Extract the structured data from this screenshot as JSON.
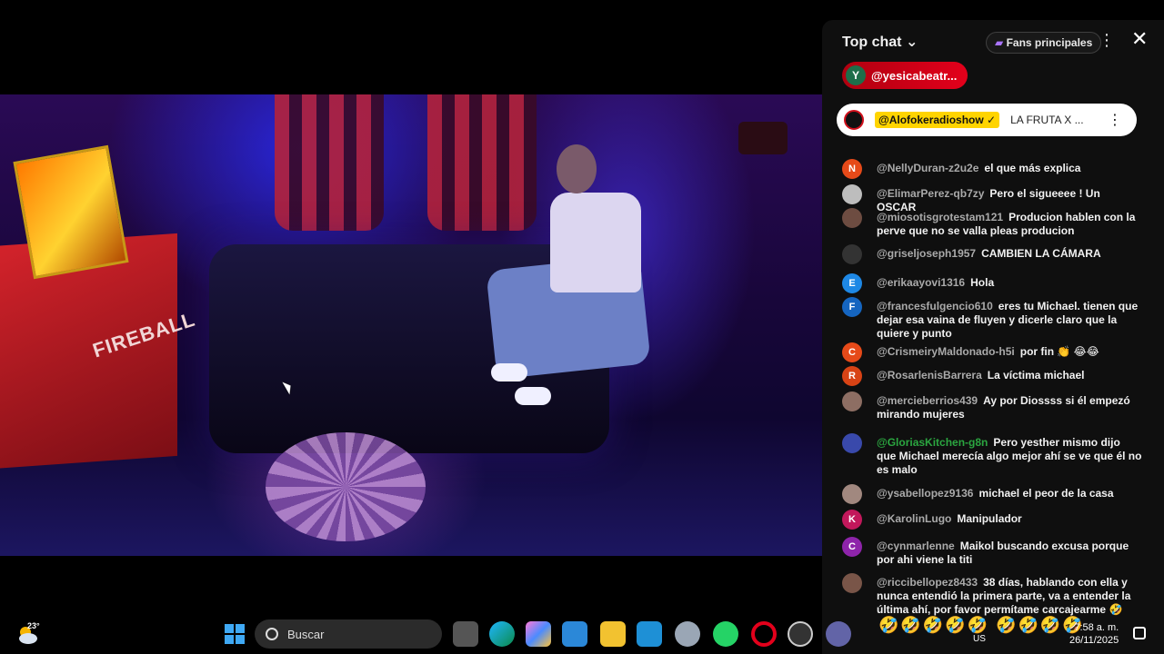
{
  "video": {
    "cabinet_text": "FIREBALL",
    "sign_text": "FIREBALL"
  },
  "chat": {
    "title": "Top chat",
    "fans_label": "Fans principales",
    "ticker": {
      "initial": "Y",
      "name": "@yesicabeatr..."
    },
    "pinned": {
      "name": "@Alofokeradioshow ✓",
      "text": "LA FRUTA X ..."
    },
    "messages": [
      {
        "initial": "N",
        "color": "#e64a19",
        "author": "@NellyDuran-z2u2e",
        "text": "el que más explica"
      },
      {
        "initial": "",
        "color": "#bdbdbd",
        "author": "@ElimarPerez-qb7zy",
        "text": "Pero el sigueeee ! Un OSCAR"
      },
      {
        "initial": "",
        "color": "#6d4c41",
        "author": "@miosotisgrotestam121",
        "text": "Producion hablen con la perve que no se valla pleas producion"
      },
      {
        "initial": "",
        "color": "#333333",
        "author": "@griseljoseph1957",
        "text": "CAMBIEN LA CÁMARA"
      },
      {
        "initial": "E",
        "color": "#1e88e5",
        "author": "@erikaayovi1316",
        "text": "Hola"
      },
      {
        "initial": "F",
        "color": "#1565c0",
        "author": "@francesfulgencio610",
        "text": "eres tu Michael. tienen que dejar esa vaina de fluyen y dicerle claro que la quiere y punto"
      },
      {
        "initial": "C",
        "color": "#e64a19",
        "author": "@CrismeiryMaldonado-h5i",
        "text": "por fin 👏 😂😂"
      },
      {
        "initial": "R",
        "color": "#d84315",
        "author": "@RosarlenisBarrera",
        "text": "La víctima michael"
      },
      {
        "initial": "",
        "color": "#8d6e63",
        "author": "@mercieberrios439",
        "text": "Ay por Diossss si él empezó mirando mujeres"
      },
      {
        "initial": "",
        "color": "#3949ab",
        "author": "@GloriasKitchen-g8n",
        "text": "Pero yesther mismo dijo que Michael merecía algo mejor ahí se ve que él no es malo",
        "green": true
      },
      {
        "initial": "",
        "color": "#a1887f",
        "author": "@ysabellopez9136",
        "text": "michael el peor de la casa"
      },
      {
        "initial": "K",
        "color": "#c2185b",
        "author": "@KarolinLugo",
        "text": "Manipulador"
      },
      {
        "initial": "C",
        "color": "#8e24aa",
        "author": "@cynmarlenne",
        "text": "Maikol buscando excusa porque por ahi viene la titi"
      },
      {
        "initial": "",
        "color": "#795548",
        "author": "@riccibellopez8433",
        "text": "38 días, hablando con ella y nunca entendió la primera parte, va a entender la última ahí, por favor permítame carcajearme 🤣"
      }
    ],
    "emoji_row": "🤣🤣🤣🤣🤣 🤣🤣🤣🤣"
  },
  "taskbar": {
    "temperature": "23°",
    "search_placeholder": "Buscar",
    "lang": "US",
    "time": "7:58 a. m.",
    "date": "26/11/2025"
  },
  "colors": {
    "accent_red": "#e3001b",
    "chat_bg": "#0f0f0f",
    "pinned_highlight": "#ffd400"
  }
}
